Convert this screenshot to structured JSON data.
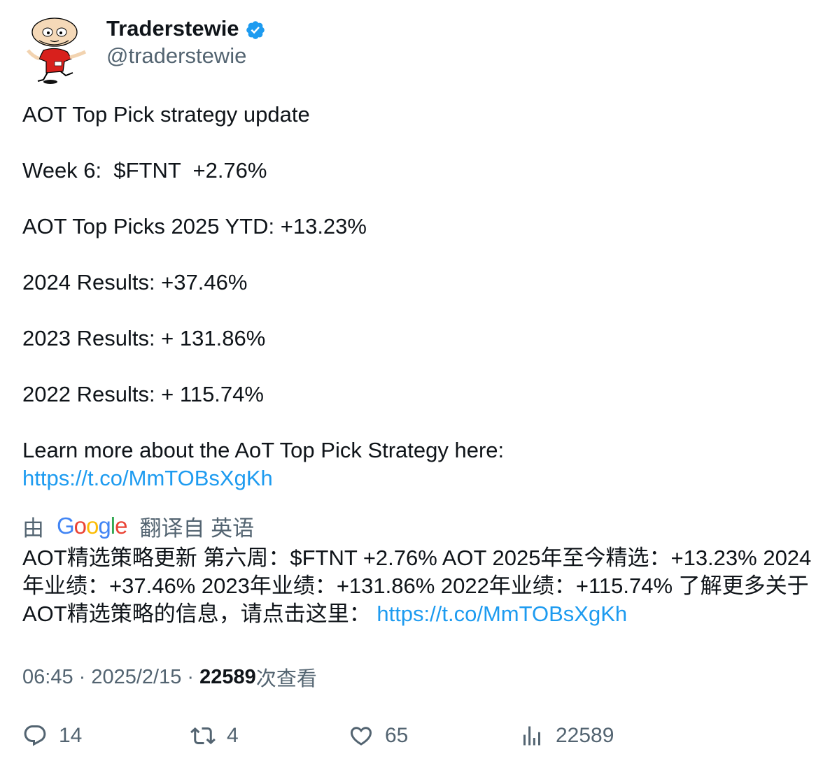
{
  "author": {
    "display_name": "Traderstewie",
    "handle": "@traderstewie",
    "verified_icon": "verified-badge-icon",
    "avatar_icon": "cartoon-avatar-icon"
  },
  "tweet": {
    "lines": [
      "AOT Top Pick strategy update",
      "",
      "Week 6:  $FTNT  +2.76%",
      "",
      "AOT Top Picks 2025 YTD: +13.23%",
      "",
      "2024 Results: +37.46%",
      "",
      "2023 Results: + 131.86%",
      "",
      "2022 Results: + 115.74%",
      "",
      "Learn more about the AoT Top Pick Strategy here:"
    ],
    "link": "https://t.co/MmTOBsXgKh"
  },
  "translation": {
    "prefix": "由",
    "provider": "Google",
    "suffix": "翻译自 英语",
    "text": "AOT精选策略更新 第六周：$FTNT +2.76% AOT 2025年至今精选：+13.23% 2024年业绩：+37.46% 2023年业绩：+131.86% 2022年业绩：+115.74% 了解更多关于AOT精选策略的信息，请点击这里： ",
    "link": "https://t.co/MmTOBsXgKh"
  },
  "meta": {
    "time": "06:45",
    "sep1": " · ",
    "date": "2025/2/15",
    "sep2": " · ",
    "views_count": "22589",
    "views_label": "次查看"
  },
  "actions": {
    "replies": "14",
    "retweets": "4",
    "likes": "65",
    "views": "22589"
  },
  "colors": {
    "text": "#0f1419",
    "secondary": "#536471",
    "link": "#1d9bf0",
    "verified": "#1d9bf0"
  }
}
